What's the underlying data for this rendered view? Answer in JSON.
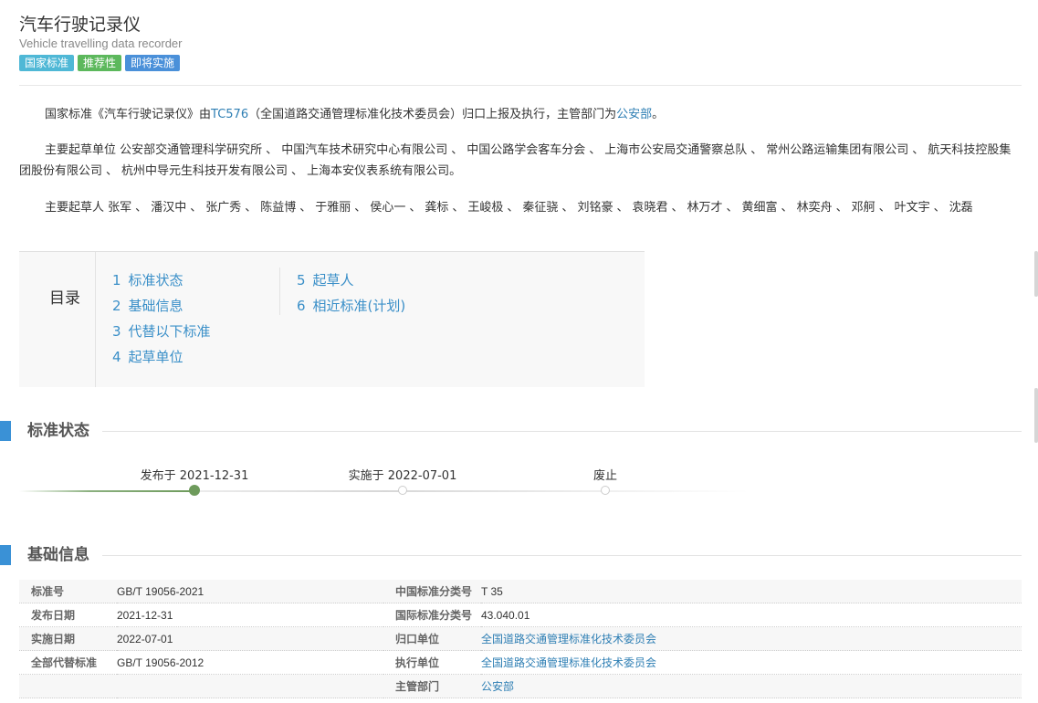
{
  "header": {
    "title": "汽车行驶记录仪",
    "subtitle": "Vehicle travelling data recorder",
    "badges": [
      {
        "label": "国家标准",
        "color": "#4fb8d6"
      },
      {
        "label": "推荐性",
        "color": "#5cb85c"
      },
      {
        "label": "即将实施",
        "color": "#4a90d9"
      }
    ]
  },
  "intro": {
    "p1_pre": "国家标准《汽车行驶记录仪》由",
    "p1_tc": "TC576",
    "p1_mid": "（全国道路交通管理标准化技术委员会）归口上报及执行，主管部门为",
    "p1_dept": "公安部",
    "p1_end": "。",
    "units_label": "主要起草单位",
    "units": [
      "公安部交通管理科学研究所",
      "中国汽车技术研究中心有限公司",
      "中国公路学会客车分会",
      "上海市公安局交通警察总队",
      "常州公路运输集团有限公司",
      "航天科技控股集团股份有限公司",
      "杭州中导元生科技开发有限公司",
      "上海本安仪表系统有限公司"
    ],
    "units_end": "。",
    "drafters_label": "主要起草人",
    "drafters": [
      "张军",
      "潘汉中",
      "张广秀",
      "陈益博",
      "于雅丽",
      "侯心一",
      "龚标",
      "王峻极",
      "秦征骁",
      "刘铭豪",
      "袁晓君",
      "林万才",
      "黄细富",
      "林奕舟",
      "邓舸",
      "叶文宇",
      "沈磊"
    ],
    "sep": "、"
  },
  "toc": {
    "label": "目录",
    "col1": [
      {
        "num": "1",
        "label": "标准状态"
      },
      {
        "num": "2",
        "label": "基础信息"
      },
      {
        "num": "3",
        "label": "代替以下标准"
      },
      {
        "num": "4",
        "label": "起草单位"
      }
    ],
    "col2": [
      {
        "num": "5",
        "label": "起草人"
      },
      {
        "num": "6",
        "label": "相近标准(计划)"
      }
    ]
  },
  "status": {
    "section_title": "标准状态",
    "published": "发布于 2021-12-31",
    "implemented": "实施于 2022-07-01",
    "abolished": "废止",
    "progress_state": "published"
  },
  "basic": {
    "section_title": "基础信息",
    "rows": [
      {
        "k1": "标准号",
        "v1": "GB/T 19056-2021",
        "k2": "中国标准分类号",
        "v2": "T 35",
        "v2_link": false
      },
      {
        "k1": "发布日期",
        "v1": "2021-12-31",
        "k2": "国际标准分类号",
        "v2": "43.040.01",
        "v2_link": false
      },
      {
        "k1": "实施日期",
        "v1": "2022-07-01",
        "k2": "归口单位",
        "v2": "全国道路交通管理标准化技术委员会",
        "v2_link": true
      },
      {
        "k1": "全部代替标准",
        "v1": "GB/T 19056-2012",
        "k2": "执行单位",
        "v2": "全国道路交通管理标准化技术委员会",
        "v2_link": true
      },
      {
        "k1": "",
        "v1": "",
        "k2": "主管部门",
        "v2": "公安部",
        "v2_link": true
      }
    ]
  },
  "colors": {
    "link": "#2f7fb4",
    "toc_link": "#3a8fc8",
    "section_bar": "#3a91d6",
    "progress_done": "#6e9b5c"
  }
}
